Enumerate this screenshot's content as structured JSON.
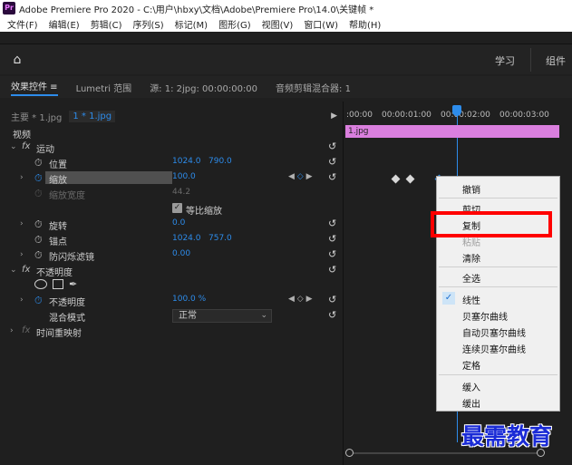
{
  "window": {
    "app_icon_text": "Pr",
    "title": "Adobe Premiere Pro 2020 - C:\\用户\\hbxy\\文档\\Adobe\\Premiere Pro\\14.0\\关键帧 *"
  },
  "menu": [
    "文件(F)",
    "编辑(E)",
    "剪辑(C)",
    "序列(S)",
    "标记(M)",
    "图形(G)",
    "视图(V)",
    "窗口(W)",
    "帮助(H)"
  ],
  "workspace": {
    "home_icon": "home-icon",
    "tabs": [
      "学习",
      "组件"
    ]
  },
  "panel_tabs": {
    "effect_controls": "效果控件 ≡",
    "lumetri_scopes": "Lumetri 范围",
    "source": "源: 1: 2jpg: 00:00:00:00",
    "audio_mixer": "音频剪辑混合器: 1"
  },
  "clip_header": {
    "master": "主要 * 1.jpg",
    "sequence": "1 * 1.jpg",
    "arrow": "▶"
  },
  "effects": {
    "video_header": "视频",
    "motion": "运动",
    "position": {
      "label": "位置",
      "x": "1024.0",
      "y": "790.0"
    },
    "scale": {
      "label": "缩放",
      "value": "100.0"
    },
    "scale_width": {
      "label": "缩放宽度",
      "value": "44.2"
    },
    "uniform_scale": "等比缩放",
    "rotation": {
      "label": "旋转",
      "value": "0.0"
    },
    "anchor": {
      "label": "锚点",
      "x": "1024.0",
      "y": "757.0"
    },
    "anti_flicker": {
      "label": "防闪烁滤镜",
      "value": "0.00"
    },
    "opacity_group": "不透明度",
    "opacity": {
      "label": "不透明度",
      "value": "100.0 %"
    },
    "blend_mode": {
      "label": "混合模式",
      "value": "正常"
    },
    "time_remap": "时间重映射"
  },
  "timeline": {
    "ticks": [
      ":00:00",
      "00:00:01:00",
      "00:00:02:00",
      "00:00:03:00"
    ],
    "clip_name": "1.jpg"
  },
  "context_menu": {
    "undo": "撤销",
    "cut": "剪切",
    "copy": "复制",
    "paste": "粘贴",
    "clear": "清除",
    "select_all": "全选",
    "linear": "线性",
    "bezier": "贝塞尔曲线",
    "auto_bezier": "自动贝塞尔曲线",
    "continuous_bezier": "连续贝塞尔曲线",
    "hold": "定格",
    "ease_in": "缓入",
    "ease_out": "缓出",
    "checked_item": "线性"
  },
  "watermark": "最需教育",
  "colors": {
    "accent": "#2d8ceb",
    "clip": "#da7fde",
    "highlight": "#ff0000",
    "watermark": "#1a2bd6"
  }
}
